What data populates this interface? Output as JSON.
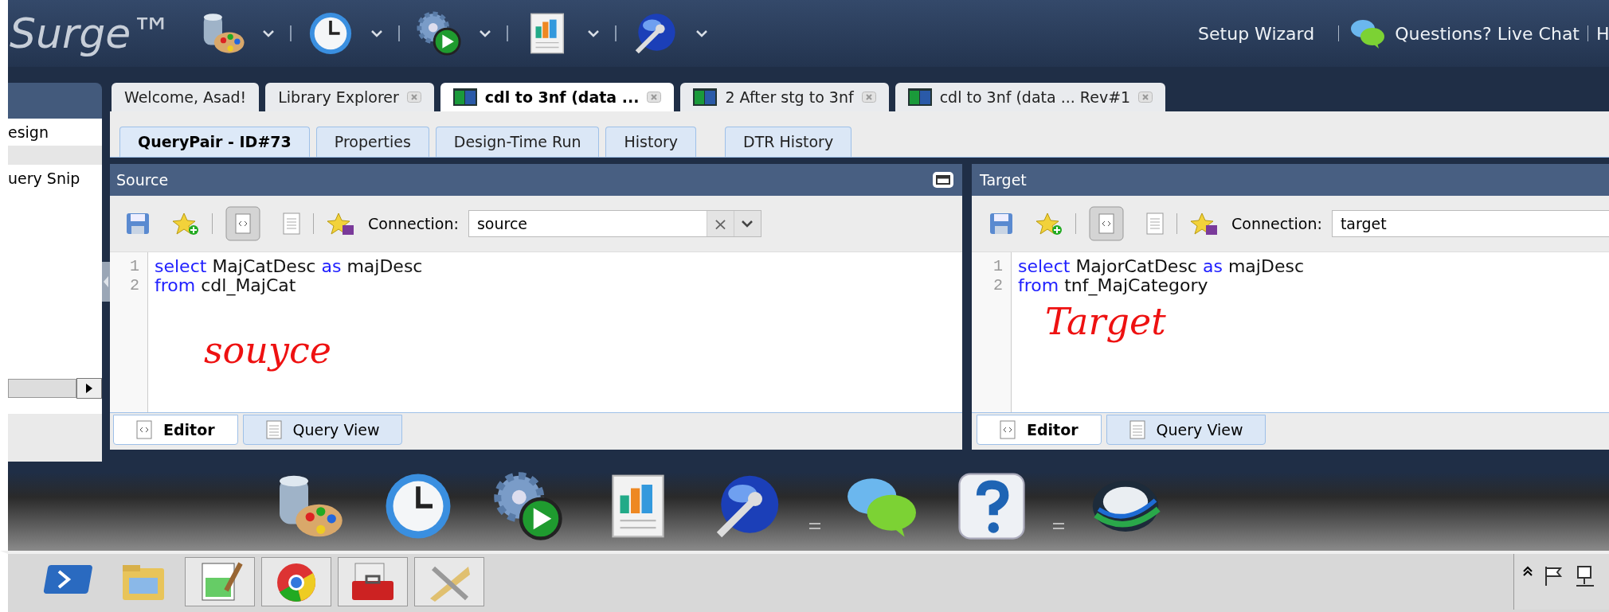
{
  "header": {
    "logo": "Surge™",
    "links": [
      "Setup Wizard",
      "Questions? Live Chat",
      "H"
    ]
  },
  "sidebar": {
    "items": [
      {
        "label": "esign"
      },
      {
        "label": "uery Snip"
      }
    ]
  },
  "document_tabs": [
    {
      "label": "Welcome, Asad!",
      "kind": "plain",
      "closable": false,
      "selected": false
    },
    {
      "label": "Library Explorer",
      "kind": "plain",
      "closable": true,
      "selected": false
    },
    {
      "label": "cdl to 3nf (data ...",
      "kind": "query",
      "closable": true,
      "selected": true
    },
    {
      "label": "2  After stg to 3nf",
      "kind": "query",
      "closable": true,
      "selected": false
    },
    {
      "label": "cdl to 3nf (data ... Rev#1",
      "kind": "query",
      "closable": true,
      "selected": false
    }
  ],
  "sub_tabs": [
    {
      "label": "QueryPair - ID#73",
      "selected": true
    },
    {
      "label": "Properties",
      "selected": false
    },
    {
      "label": "Design-Time Run",
      "selected": false
    },
    {
      "label": "History",
      "selected": false
    },
    {
      "label": "DTR History",
      "selected": false
    }
  ],
  "panels": [
    {
      "title": "Source",
      "maximizable": true,
      "connection_label": "Connection:",
      "connection": "source",
      "clear": "×",
      "lines": [
        {
          "number": "1",
          "tokens": [
            {
              "text": "select",
              "keyword": true
            },
            {
              "text": "MajCatDesc",
              "keyword": false
            },
            {
              "text": "as",
              "keyword": true
            },
            {
              "text": "majDesc",
              "keyword": false
            }
          ]
        },
        {
          "number": "2",
          "tokens": [
            {
              "text": "from",
              "keyword": true
            },
            {
              "text": "cdl_MajCat",
              "keyword": false
            }
          ]
        }
      ],
      "annotation": "souyce",
      "bottom_tabs": [
        {
          "label": "Editor",
          "selected": true
        },
        {
          "label": "Query View",
          "selected": false
        }
      ]
    },
    {
      "title": "Target",
      "maximizable": false,
      "connection_label": "Connection:",
      "connection": "target",
      "lines": [
        {
          "number": "1",
          "tokens": [
            {
              "text": "select",
              "keyword": true
            },
            {
              "text": "MajorCatDesc",
              "keyword": false
            },
            {
              "text": "as",
              "keyword": true
            },
            {
              "text": "majDesc",
              "keyword": false
            }
          ]
        },
        {
          "number": "2",
          "tokens": [
            {
              "text": "from",
              "keyword": true
            },
            {
              "text": "tnf_MajCategory",
              "keyword": false
            }
          ]
        }
      ],
      "annotation": "Target",
      "bottom_tabs": [
        {
          "label": "Editor",
          "selected": true
        },
        {
          "label": "Query View",
          "selected": false
        }
      ]
    }
  ]
}
